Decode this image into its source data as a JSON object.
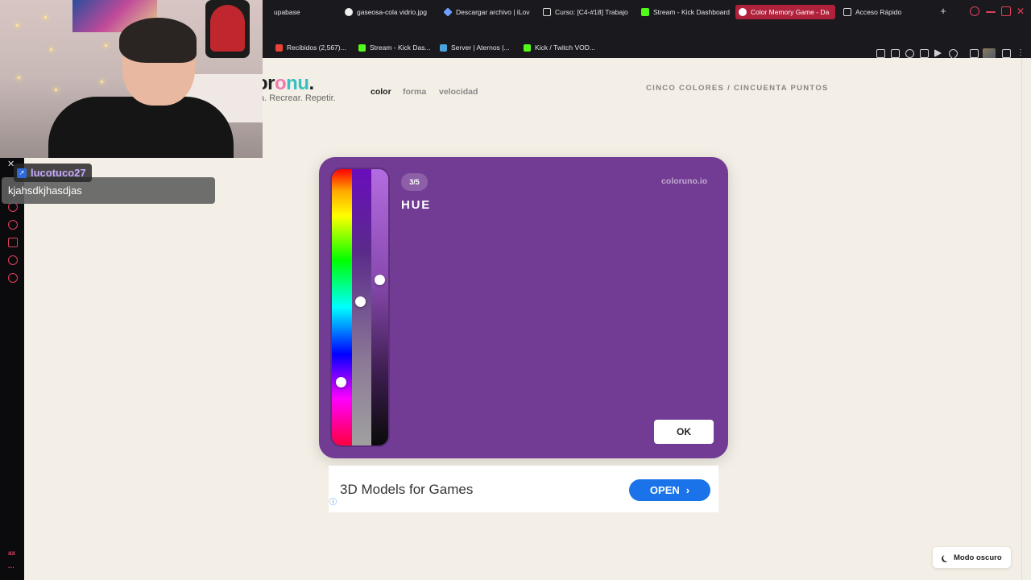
{
  "browser": {
    "tabs": [
      {
        "label": "upabase",
        "active": false
      },
      {
        "label": "gaseosa-cola vidrio.jpg",
        "active": false
      },
      {
        "label": "Descargar archivo | iLov",
        "active": false
      },
      {
        "label": "Curso: [C4-#18] Trabajo",
        "active": false
      },
      {
        "label": "Stream - Kick Dashboard",
        "active": false
      },
      {
        "label": "Color Memory Game - Da",
        "active": true
      },
      {
        "label": "Acceso Rápido",
        "active": false
      }
    ],
    "new_tab": "+",
    "bookmarks": [
      {
        "label": "Recibidos (2,567)..."
      },
      {
        "label": "Stream - Kick Das..."
      },
      {
        "label": "Server | Aternos |..."
      },
      {
        "label": "Kick / Twitch VOD..."
      }
    ]
  },
  "site": {
    "logo": {
      "part1": "or",
      "part2": "o",
      "part3": "nu",
      "part4": "."
    },
    "tagline": "a. Recrear. Repetir.",
    "nav": [
      "color",
      "forma",
      "velocidad"
    ],
    "header_right": "CINCO COLORES / CINCUENTA PUNTOS"
  },
  "game": {
    "counter": "3/5",
    "mode": "HUE",
    "watermark": "coloruno.io",
    "ok": "OK",
    "card_color": "#733c94",
    "hue_level": 0.77,
    "saturation_level": 0.48,
    "lightness_level": 0.4
  },
  "ad": {
    "text": "3D Models for Games",
    "button": "OPEN"
  },
  "dark_mode": "Modo oscuro",
  "chat": {
    "username": "lucotuco27",
    "message": "kjahsdkjhasdjas"
  },
  "sidebar": {
    "label": "ax"
  },
  "colors": {
    "accent": "#b0213b",
    "page_bg": "#f3efe6",
    "ad_button": "#1a73e8"
  }
}
